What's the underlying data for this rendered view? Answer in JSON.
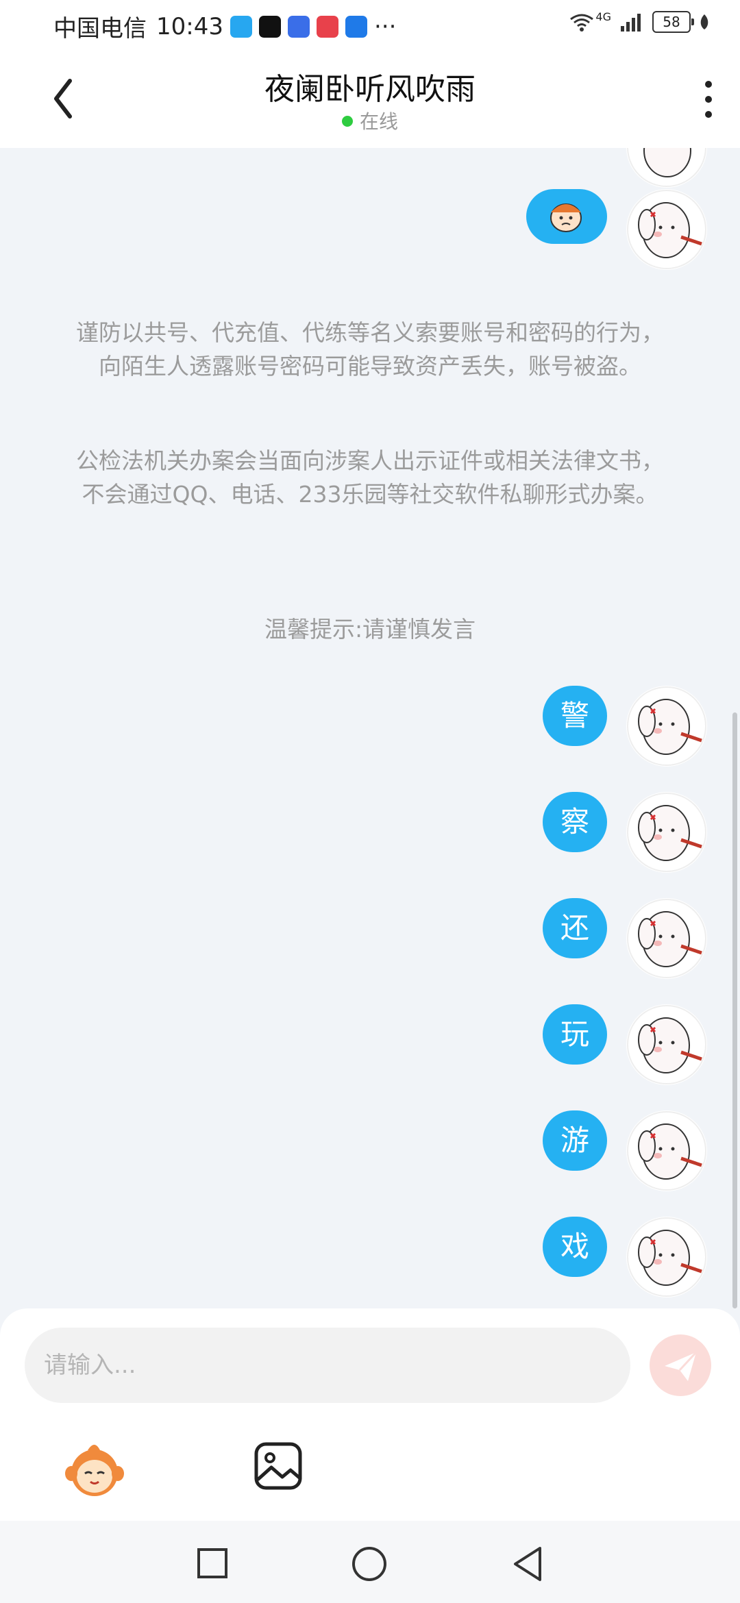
{
  "status_bar": {
    "carrier": "中国电信",
    "time": "10:43",
    "more": "···",
    "network": "4G",
    "battery": "58"
  },
  "header": {
    "title": "夜阑卧听风吹雨",
    "status": "在线",
    "icons": {
      "back": "chevron-left-icon",
      "more": "more-vertical-icon"
    }
  },
  "notice": {
    "security": "谨防以共号、代充值、代练等名义索要账号和密码的行为，向陌生人透露账号密码可能导致资产丢失，账号被盗。",
    "police": "公检法机关办案会当面向涉案人出示证件或相关法律文书，不会通过QQ、电话、233乐园等社交软件私聊形式办案。"
  },
  "tip": "温馨提示:请谨慎发言",
  "messages": [
    "警",
    "察",
    "还",
    "玩",
    "游",
    "戏"
  ],
  "composer": {
    "placeholder": "请输入...",
    "icons": {
      "send": "paper-plane-icon",
      "emoji": "emoji-face-icon",
      "image": "image-icon"
    }
  },
  "colors": {
    "bubble": "#25b1f2",
    "online_dot": "#2ecc40",
    "send_button": "#fbdcd9"
  }
}
